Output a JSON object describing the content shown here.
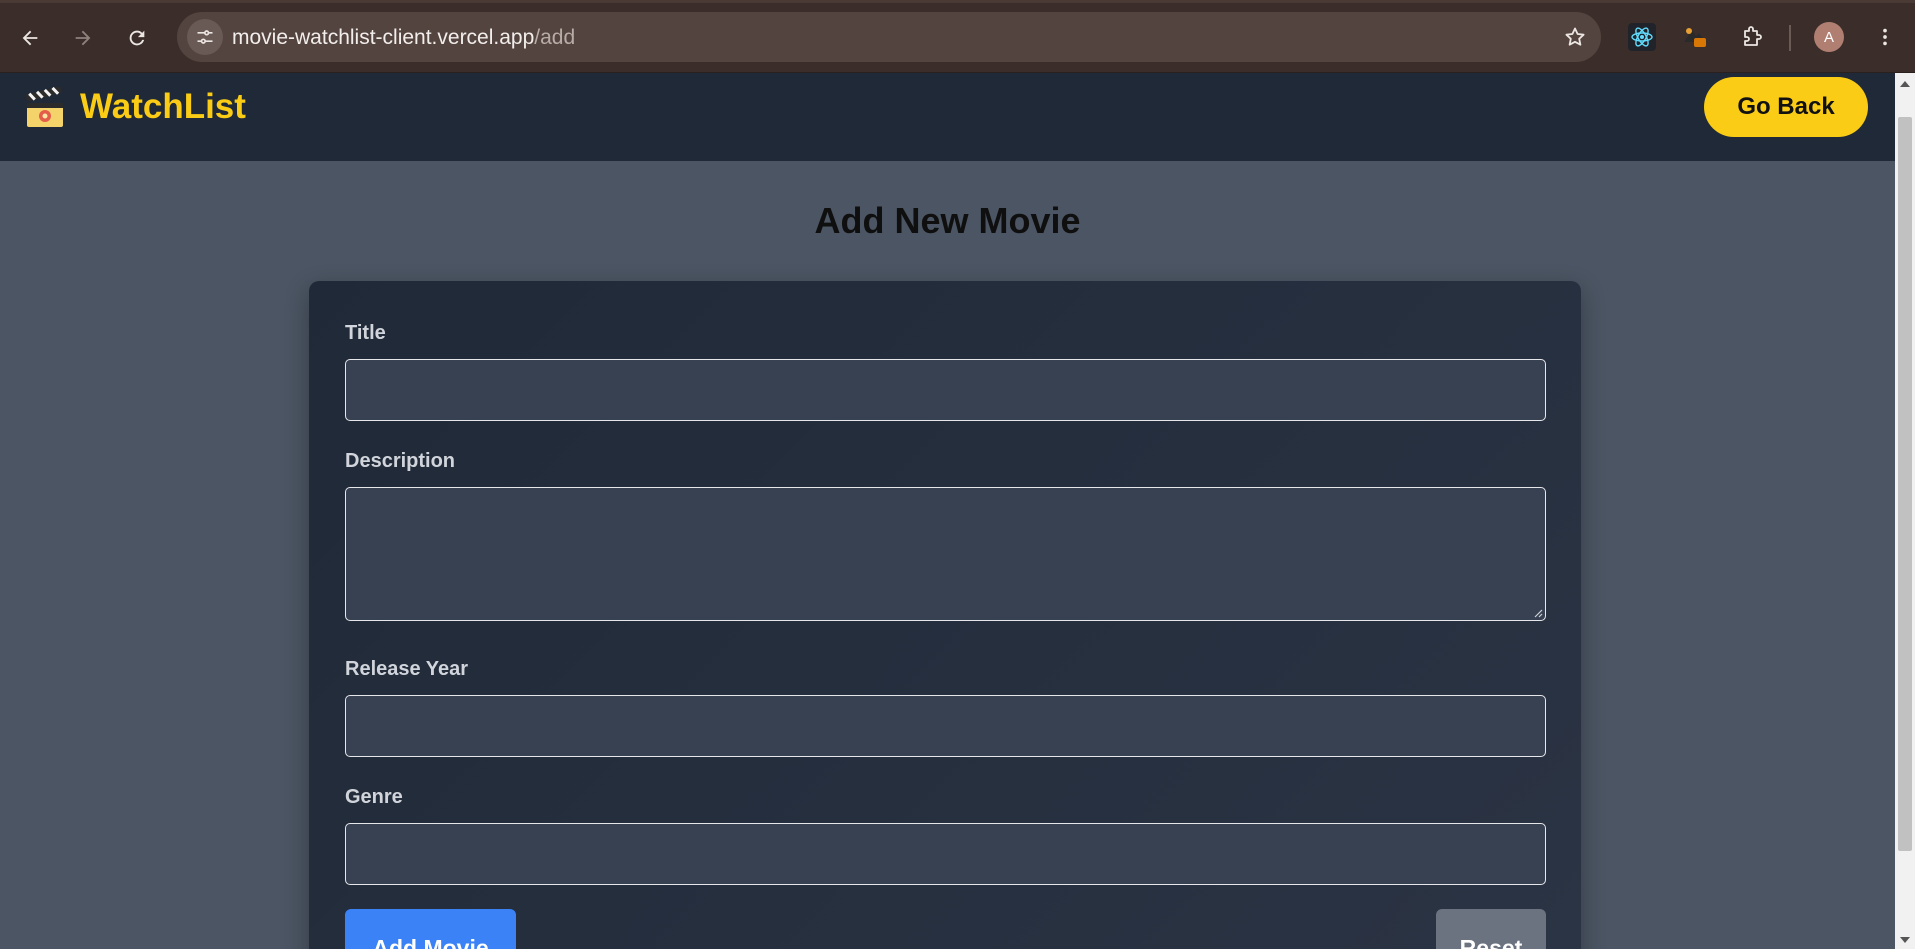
{
  "browser": {
    "url_host": "movie-watchlist-client.vercel.app",
    "url_path": "/add",
    "avatar_letter": "A"
  },
  "header": {
    "logo_emoji": "🎬",
    "title": "WatchList",
    "go_back_label": "Go Back"
  },
  "main": {
    "page_title": "Add New Movie",
    "form": {
      "title_label": "Title",
      "description_label": "Description",
      "release_year_label": "Release Year",
      "genre_label": "Genre",
      "add_label": "Add Movie",
      "reset_label": "Reset"
    }
  },
  "colors": {
    "accent": "#facc15",
    "header_bg": "#1f2937",
    "page_bg": "#4b5563",
    "primary_button": "#3b82f6",
    "secondary_button": "#6b7280"
  }
}
